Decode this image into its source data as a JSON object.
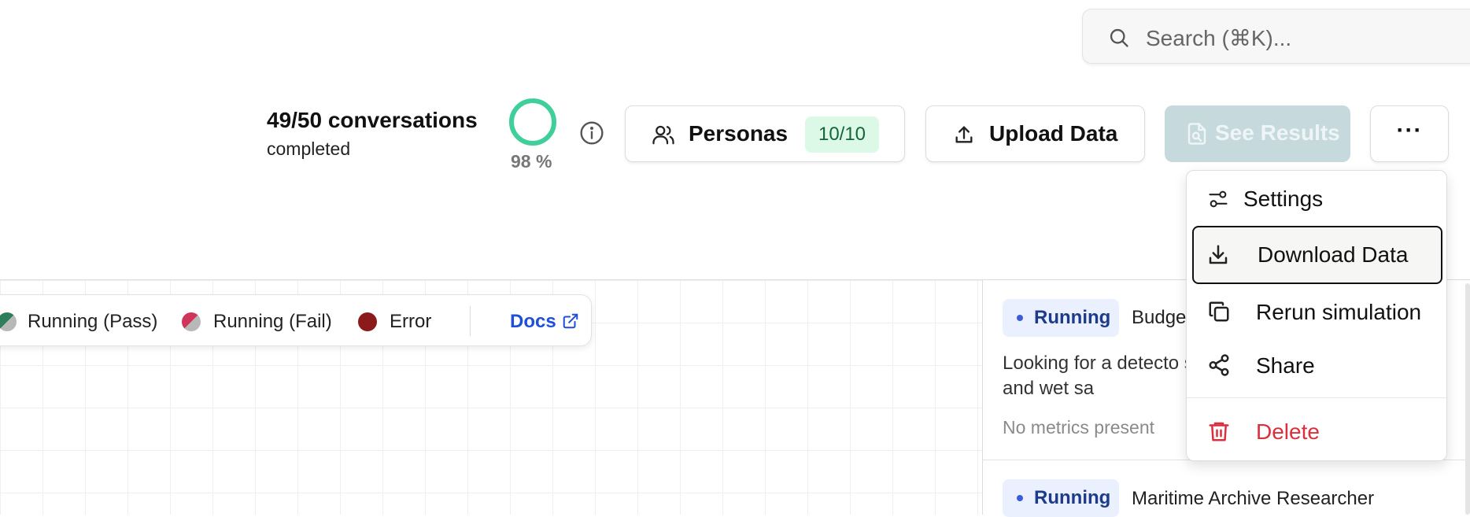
{
  "search": {
    "placeholder": "Search (⌘K)..."
  },
  "progress": {
    "count_label": "49/50 conversations",
    "status_label": "completed",
    "percent_label": "98 %",
    "percent_value": 98
  },
  "toolbar": {
    "personas_label": "Personas",
    "personas_badge": "10/10",
    "upload_label": "Upload Data",
    "results_label": "See Results",
    "more_label": "···"
  },
  "legend": {
    "items": [
      {
        "label": "Running (Pass)"
      },
      {
        "label": "Running (Fail)"
      },
      {
        "label": "Error"
      }
    ],
    "docs_label": "Docs"
  },
  "menu": {
    "items": [
      {
        "label": "Settings"
      },
      {
        "label": "Download Data"
      },
      {
        "label": "Rerun simulation"
      },
      {
        "label": "Share"
      },
      {
        "label": "Delete"
      }
    ]
  },
  "simulations": [
    {
      "status": "Running",
      "persona": "Budge",
      "description": "Looking for a detecto saltwater and wet sa",
      "metrics": "No metrics present"
    },
    {
      "status": "Running",
      "persona": "Maritime Archive Researcher"
    }
  ],
  "colors": {
    "accent": "#3ecf9a",
    "link": "#1f4fd8",
    "danger": "#dc2f3e",
    "pass": "#2e7d5b",
    "fail": "#d1345b",
    "error": "#8b1a1a",
    "badge_bg": "#dcf8e6"
  }
}
